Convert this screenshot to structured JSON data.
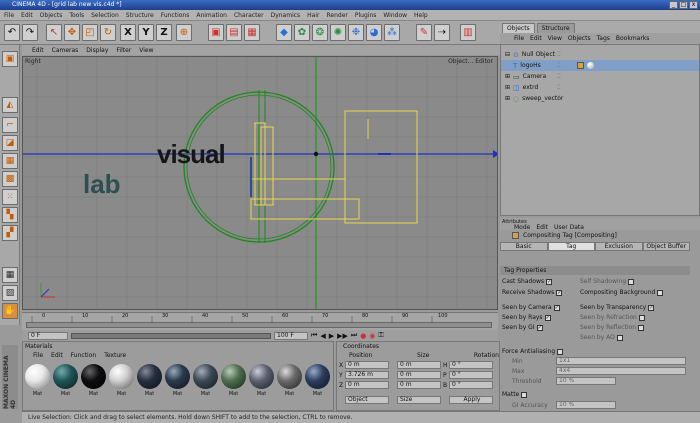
{
  "app": {
    "title": "CINEMA 4D - [grid lab new vis.c4d *]",
    "vertical_brand": "MAXON CINEMA 4D"
  },
  "window_buttons": [
    "_",
    "□",
    "x"
  ],
  "menu": [
    "File",
    "Edit",
    "Objects",
    "Tools",
    "Selection",
    "Structure",
    "Functions",
    "Animation",
    "Character",
    "Dynamics",
    "Hair",
    "Render",
    "Plugins",
    "Window",
    "Help"
  ],
  "viewport": {
    "menu": [
      "Edit",
      "Cameras",
      "Display",
      "Filter",
      "View"
    ],
    "label_left": "Right",
    "label_right": "Object... Editor",
    "text_visual": "visual",
    "text_lab": "lab"
  },
  "timeline": {
    "ticks": [
      "0",
      "10",
      "20",
      "30",
      "40",
      "50",
      "60",
      "70",
      "80",
      "90",
      "100"
    ],
    "start": "0 F",
    "end": "100 F",
    "current": "0 F"
  },
  "materials": {
    "title": "Materials",
    "menu": [
      "File",
      "Edit",
      "Function",
      "Texture"
    ],
    "swatches": [
      {
        "label": "Mat",
        "color": "#e8e8e8"
      },
      {
        "label": "Mat",
        "color": "#1f5557"
      },
      {
        "label": "Mat",
        "color": "#0d0d10"
      },
      {
        "label": "Mat",
        "color": "#cfcfcf"
      },
      {
        "label": "Mat",
        "color": "#25303e"
      },
      {
        "label": "Mat",
        "color": "#2a3a4e"
      },
      {
        "label": "Mat",
        "color": "#3b4a55"
      },
      {
        "label": "Mat",
        "color": "#4e6e4e"
      },
      {
        "label": "Mat",
        "color": "#5a6270"
      },
      {
        "label": "Mat",
        "color": "#6a6a6a"
      },
      {
        "label": "Mat",
        "color": "#2c3e5e"
      }
    ]
  },
  "coordinates": {
    "title": "Coordinates",
    "headers": [
      "Position",
      "Size",
      "Rotation"
    ],
    "rows": [
      {
        "axis": "X",
        "pos": "0 m",
        "size": "0 m",
        "rot_axis": "H",
        "rot": "0 °"
      },
      {
        "axis": "Y",
        "pos": "3.726 m",
        "size": "0 m",
        "rot_axis": "P",
        "rot": "0 °"
      },
      {
        "axis": "Z",
        "pos": "0 m",
        "size": "0 m",
        "rot_axis": "B",
        "rot": "0 °"
      }
    ],
    "mode_select": "Object",
    "size_select": "Size",
    "apply_label": "Apply"
  },
  "object_manager": {
    "tabs": [
      "Objects",
      "Structure"
    ],
    "menu": [
      "File",
      "Edit",
      "View",
      "Objects",
      "Tags",
      "Bookmarks"
    ],
    "items": [
      {
        "name": "Null Object",
        "depth": 0
      },
      {
        "name": "logoHs",
        "depth": 1
      },
      {
        "name": "Camera",
        "depth": 0
      },
      {
        "name": "extrd",
        "depth": 0
      },
      {
        "name": "sweep_vector",
        "depth": 0
      }
    ]
  },
  "attributes": {
    "title": "Attributes",
    "menu": [
      "Mode",
      "Edit",
      "User Data"
    ],
    "tag_title": "Compositing Tag [Compositing]",
    "tabs": [
      "Basic",
      "Tag",
      "Exclusion",
      "Object Buffer"
    ],
    "active_tab": "Tag",
    "section": "Tag Properties",
    "props_left": [
      "Cast Shadows",
      "Receive Shadows",
      "Seen by Camera",
      "Seen by Rays",
      "Seen by GI"
    ],
    "props_right": [
      "Self Shadowing",
      "Compositing Background",
      "Seen by Transparency",
      "Seen by Refraction",
      "Seen by Reflection",
      "Seen by AO"
    ],
    "antialias": {
      "label": "Force Antialiasing",
      "fields": [
        {
          "label": "Min",
          "value": "1x1"
        },
        {
          "label": "Max",
          "value": "4x4"
        },
        {
          "label": "Threshold",
          "value": "10 %"
        }
      ]
    },
    "matte": {
      "label": "Matte",
      "fields": [
        {
          "label": "GI Accuracy",
          "value": "10 %"
        }
      ]
    }
  },
  "status": "Live Selection: Click and drag to select elements. Hold down SHIFT to add to the selection, CTRL to remove."
}
